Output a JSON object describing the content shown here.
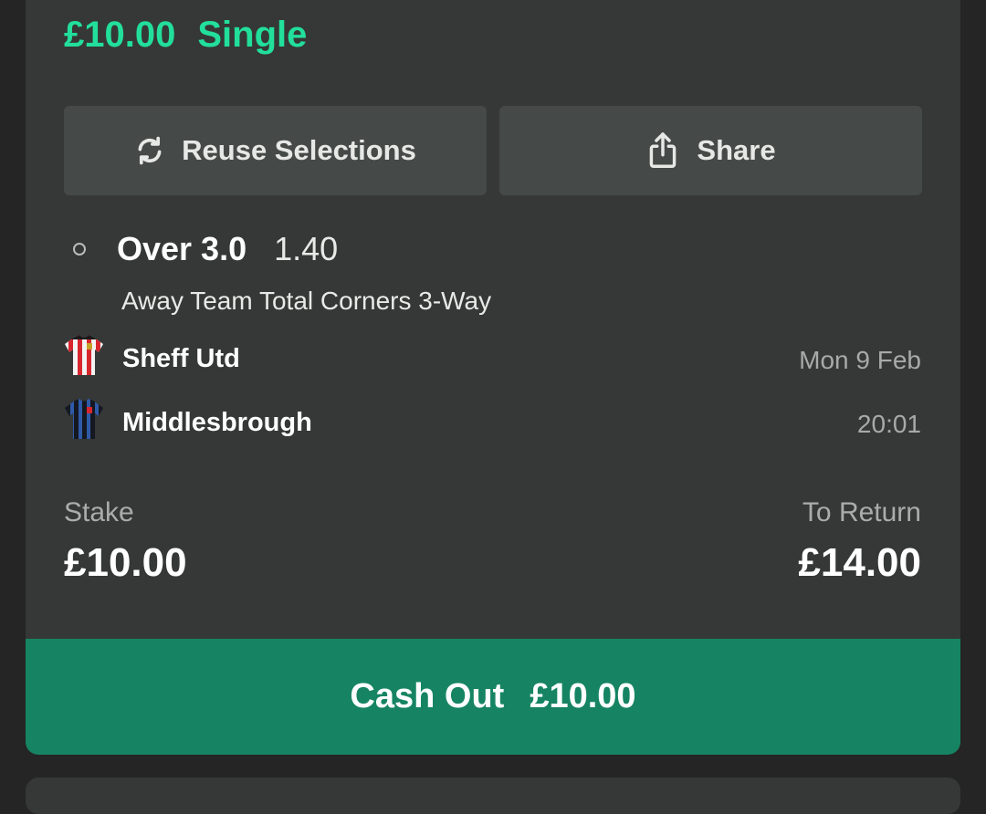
{
  "bet": {
    "stake_display": "£10.00",
    "type": "Single"
  },
  "actions": {
    "reuse_label": "Reuse Selections",
    "reuse_icon": "refresh-icon",
    "share_label": "Share",
    "share_icon": "share-icon"
  },
  "selection": {
    "name": "Over 3.0",
    "odds": "1.40",
    "market": "Away Team Total Corners 3-Way"
  },
  "match": {
    "home_team": "Sheff Utd",
    "away_team": "Middlesbrough",
    "date": "Mon 9 Feb",
    "time": "20:01"
  },
  "summary": {
    "stake_label": "Stake",
    "stake_value": "£10.00",
    "return_label": "To Return",
    "return_value": "£14.00"
  },
  "cashout": {
    "label": "Cash Out",
    "amount": "£10.00"
  },
  "colors": {
    "accent_green": "#22df9c",
    "cashout_green": "#168463",
    "card_bg": "#353836"
  }
}
